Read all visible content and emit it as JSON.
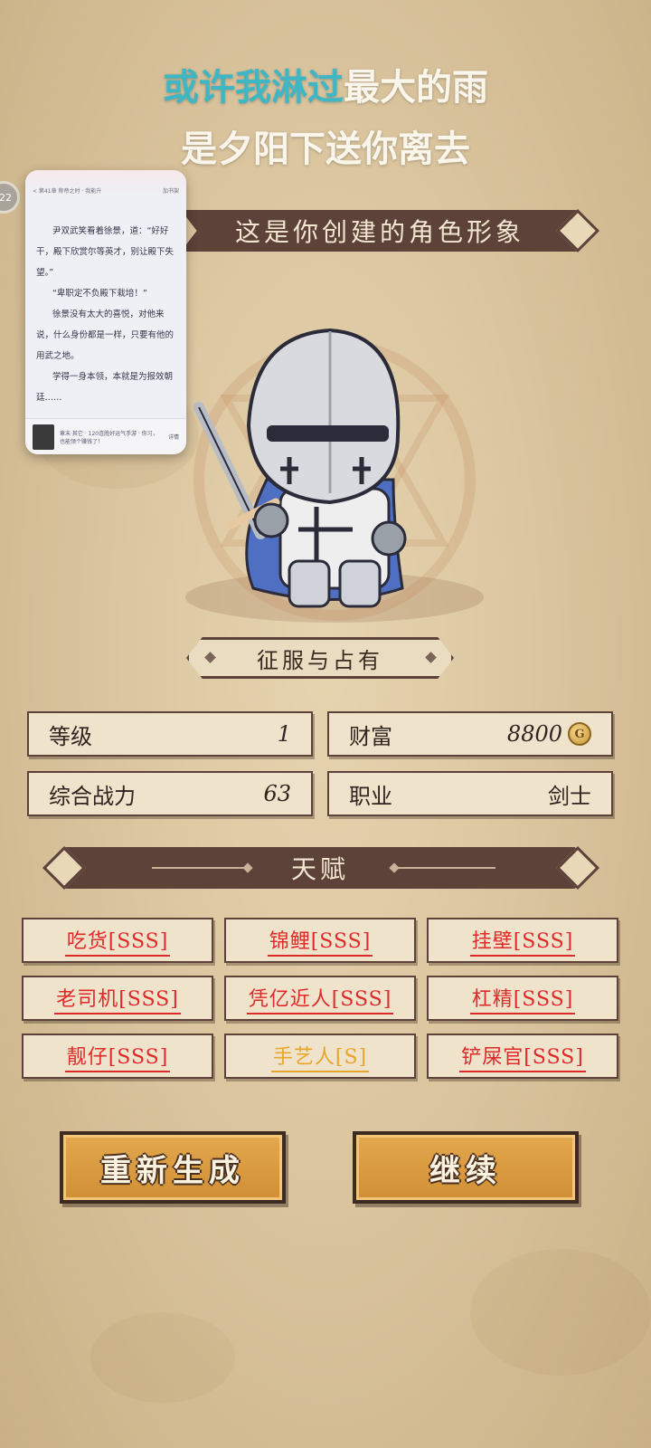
{
  "lyrics": {
    "line1_highlight": "或许我淋过",
    "line1_rest": "最大的雨",
    "line2": "是夕阳下送你离去"
  },
  "title_banner": "这是你创建的角色形象",
  "character_class": "征服与占有",
  "stats": {
    "level_label": "等级",
    "level_value": "1",
    "wealth_label": "财富",
    "wealth_value": "8800",
    "coin_symbol": "G",
    "power_label": "综合战力",
    "power_value": "63",
    "job_label": "职业",
    "job_value": "剑士"
  },
  "talents_title": "天赋",
  "talents": [
    {
      "label": "吃货[SSS]",
      "color": "#e02a2a"
    },
    {
      "label": "锦鲤[SSS]",
      "color": "#e02a2a"
    },
    {
      "label": "挂壁[SSS]",
      "color": "#e02a2a"
    },
    {
      "label": "老司机[SSS]",
      "color": "#e02a2a"
    },
    {
      "label": "凭亿近人[SSS]",
      "color": "#e02a2a"
    },
    {
      "label": "杠精[SSS]",
      "color": "#e02a2a"
    },
    {
      "label": "靓仔[SSS]",
      "color": "#e02a2a"
    },
    {
      "label": "手艺人[S]",
      "color": "#e7a62a"
    },
    {
      "label": "铲屎官[SSS]",
      "color": "#e02a2a"
    }
  ],
  "buttons": {
    "regenerate": "重新生成",
    "continue": "继续"
  },
  "reader_window": {
    "header_left": "< 第41章 称帝之时 · 我能升",
    "header_right": "加书架",
    "paragraphs": [
      "尹双武笑看着徐景，道：“好好干，殿下欣赏尔等英才，别让殿下失望。”",
      "“卑职定不负殿下栽培！”",
      "徐景没有太大的喜悦，对他来说，什么身份都是一样，只要有他的用武之地。",
      "学得一身本领，本就是为报效朝廷……"
    ],
    "footer_text": "章末·其它 · 120连胜好运气手游 · 你习，也能领个赚钱了！",
    "footer_action": "详情",
    "side_badge": "22"
  }
}
